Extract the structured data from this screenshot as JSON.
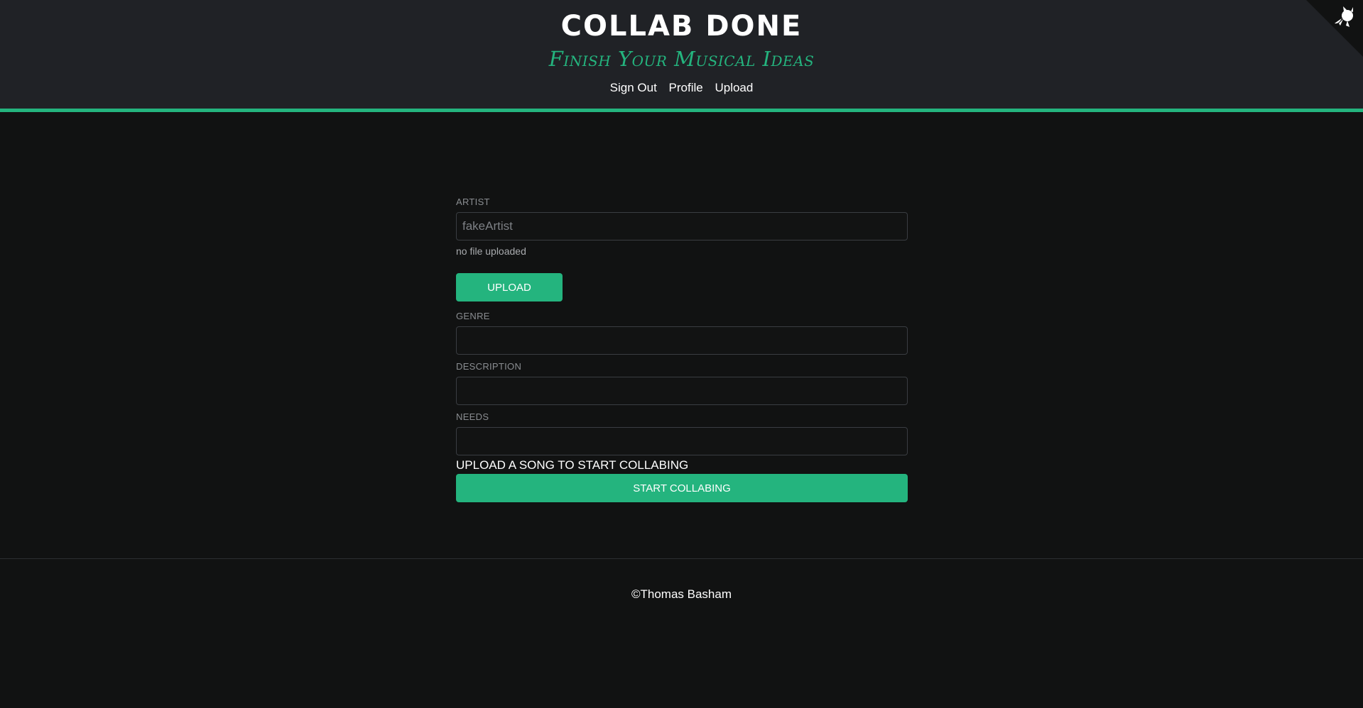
{
  "header": {
    "title": "COLLAB DONE",
    "subtitle": "Finish Your Musical Ideas",
    "nav": [
      {
        "label": "Sign Out"
      },
      {
        "label": "Profile"
      },
      {
        "label": "Upload"
      }
    ],
    "corner_icon": "github-octocat-icon"
  },
  "form": {
    "artist": {
      "label": "ARTIST",
      "placeholder": "fakeArtist",
      "value": ""
    },
    "file_status": "no file uploaded",
    "upload_button": "UPLOAD",
    "genre": {
      "label": "GENRE",
      "value": ""
    },
    "description": {
      "label": "DESCRIPTION",
      "value": ""
    },
    "needs": {
      "label": "NEEDS",
      "value": ""
    },
    "prompt": "UPLOAD A SONG TO START COLLABING",
    "submit_button": "START COLLABING"
  },
  "footer": {
    "copyright": "©Thomas Basham"
  },
  "colors": {
    "accent": "#24b47e",
    "header_bg": "#202226",
    "page_bg": "#111212"
  }
}
